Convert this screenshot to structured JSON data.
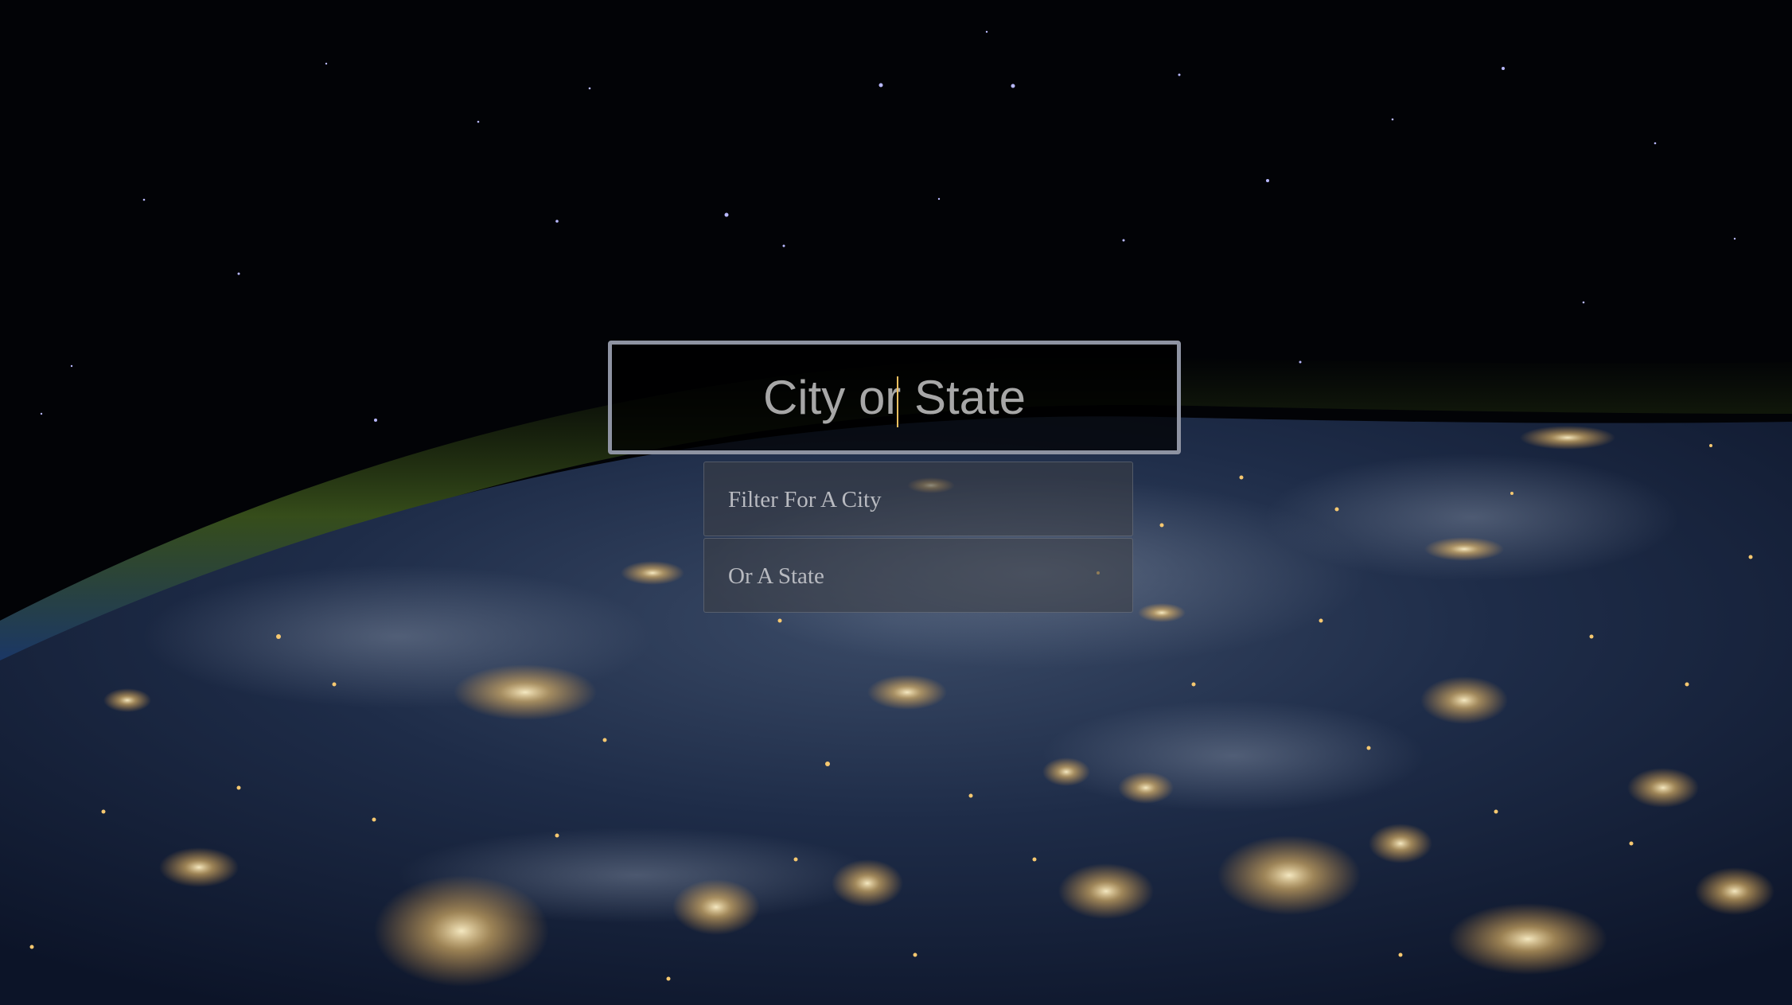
{
  "search": {
    "placeholder": "City or State",
    "value": ""
  },
  "suggestions": [
    {
      "label": "Filter For A City"
    },
    {
      "label": "Or A State"
    }
  ],
  "colors": {
    "space": "#020306",
    "atmosphere": "#4a6a2a",
    "earth": "#1c2a44",
    "city_lights": "#f5c46a",
    "input_border": "#8e93a2"
  }
}
